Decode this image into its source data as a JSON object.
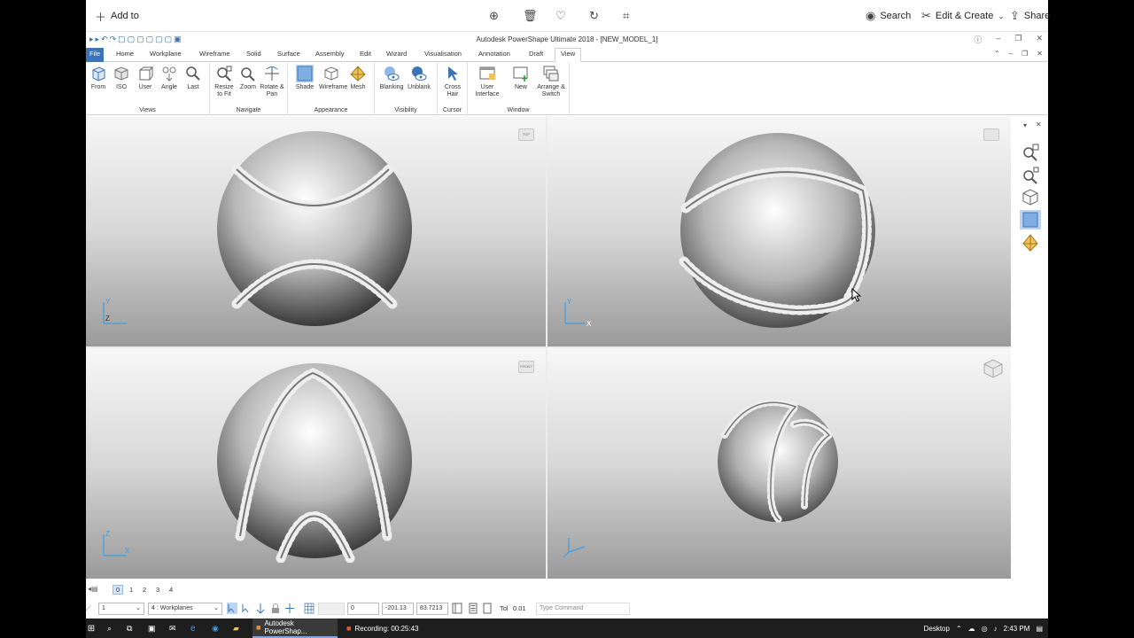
{
  "photos_toolbar": {
    "add_to_label": "Add to",
    "search_label": "Search",
    "edit_create_label": "Edit & Create",
    "share_label": "Share"
  },
  "app": {
    "title": "Autodesk PowerShape Ultimate 2018 - [NEW_MODEL_1]",
    "tabs": [
      "File",
      "Home",
      "Workplane",
      "Wireframe",
      "Solid",
      "Surface",
      "Assembly",
      "Edit",
      "Wizard",
      "Visualisation",
      "Annotation",
      "Draft",
      "View"
    ],
    "active_tab": "View",
    "ribbon": {
      "groups": [
        {
          "label": "Views",
          "buttons": [
            "From",
            "ISO",
            "User",
            "Angle",
            "Last"
          ]
        },
        {
          "label": "Navigate",
          "buttons": [
            "Resize to Fit",
            "Zoom",
            "Rotate & Pan"
          ]
        },
        {
          "label": "Appearance",
          "buttons": [
            "Shade",
            "Wireframe",
            "Mesh"
          ]
        },
        {
          "label": "Visibility",
          "buttons": [
            "Blanking",
            "Unblank"
          ]
        },
        {
          "label": "Cursor",
          "buttons": [
            "Cross Hair"
          ]
        },
        {
          "label": "Window",
          "buttons": [
            "User Interface",
            "New",
            "Arrange & Switch"
          ]
        }
      ]
    },
    "viewports": [
      {
        "name": "top-view",
        "axis_labels": [
          "Y",
          "Z"
        ],
        "label": "TOP"
      },
      {
        "name": "right-view",
        "axis_labels": [
          "Y",
          "X"
        ],
        "label": ""
      },
      {
        "name": "front-view",
        "axis_labels": [
          "Z",
          "X"
        ],
        "label": "FRONT"
      },
      {
        "name": "iso-view",
        "axis_labels": [],
        "label": ""
      }
    ],
    "layers": [
      "0",
      "1",
      "2",
      "3",
      "4"
    ],
    "status": {
      "level_value": "1",
      "workplane_value": "4",
      "workplane_label": ": Workplanes",
      "coord_x": "0",
      "coord_y": "-201.13",
      "coord_z": "83.7213",
      "tol_label": "Tol",
      "tol_value": "0.01",
      "command_placeholder": "Type Command"
    }
  },
  "taskbar": {
    "app1": "Autodesk PowerShap...",
    "app2": "Recording: 00:25:43",
    "desktop_label": "Desktop",
    "time": "2:43 PM"
  },
  "colors": {
    "accent": "#3c74b8",
    "taskbar": "#1e1e1e",
    "viewport_top": "#f7f7f7",
    "viewport_bottom": "#9a9a9a"
  }
}
